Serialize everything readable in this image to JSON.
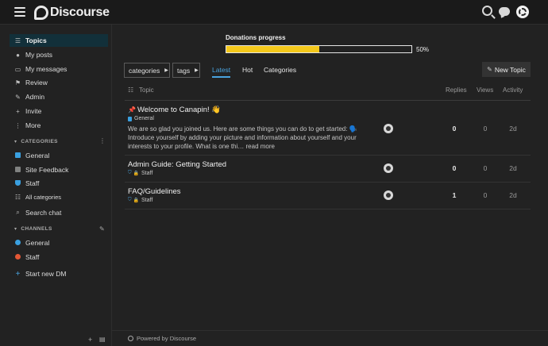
{
  "header": {
    "logo_text": "Discourse",
    "icons": [
      "hamburger-icon",
      "search-icon",
      "chat-icon",
      "avatar"
    ]
  },
  "sidebar": {
    "items": [
      {
        "label": "Topics",
        "icon": "layers-icon",
        "active": true
      },
      {
        "label": "My posts",
        "icon": "user-icon"
      },
      {
        "label": "My messages",
        "icon": "inbox-icon"
      },
      {
        "label": "Review",
        "icon": "flag-icon"
      },
      {
        "label": "Admin",
        "icon": "wrench-icon"
      },
      {
        "label": "Invite",
        "icon": "user-plus-icon"
      },
      {
        "label": "More",
        "icon": "ellipsis-vertical-icon"
      }
    ],
    "categories_heading": "CATEGORIES",
    "categories": [
      {
        "label": "General",
        "color": "#3aa0e0"
      },
      {
        "label": "Site Feedback",
        "color": "#808281"
      },
      {
        "label": "Staff",
        "color": "#3aa0e0"
      }
    ],
    "all_categories": "All categories",
    "search_chat": "Search chat",
    "channels_heading": "CHANNELS",
    "channels": [
      {
        "label": "General",
        "color": "#3aa0e0"
      },
      {
        "label": "Staff",
        "color": "#e45735"
      }
    ],
    "start_dm": "Start new DM"
  },
  "donations": {
    "title": "Donations progress",
    "percent_label": "50%",
    "progress": 0.5,
    "bar_color": "#f4c81b"
  },
  "filters": {
    "categories": "categories",
    "tags": "tags"
  },
  "nav": {
    "latest": "Latest",
    "hot": "Hot",
    "categories": "Categories",
    "new_topic": "New Topic"
  },
  "table": {
    "headers": {
      "topic": "Topic",
      "replies": "Replies",
      "views": "Views",
      "activity": "Activity"
    },
    "rows": [
      {
        "title": "Welcome to Canapin! 👋",
        "pinned": true,
        "category": "General",
        "category_color": "#3aa0e0",
        "excerpt": "We are so glad you joined us. Here are some things you can do to get started: 🗣️ Introduce yourself by adding your picture and information about yourself and your interests to your profile. What is one thi… read more",
        "replies": "0",
        "views": "0",
        "activity": "2d"
      },
      {
        "title": "Admin Guide: Getting Started",
        "category": "Staff",
        "category_color": "#3aa0e0",
        "replies": "0",
        "views": "0",
        "activity": "2d"
      },
      {
        "title": "FAQ/Guidelines",
        "category": "Staff",
        "category_color": "#3aa0e0",
        "replies": "1",
        "views": "0",
        "activity": "2d"
      }
    ]
  },
  "footer": {
    "powered_by": "Powered by Discourse"
  },
  "colors": {
    "background": "#222222",
    "accent": "#4aa3df",
    "active_sidebar": "#12303a"
  }
}
